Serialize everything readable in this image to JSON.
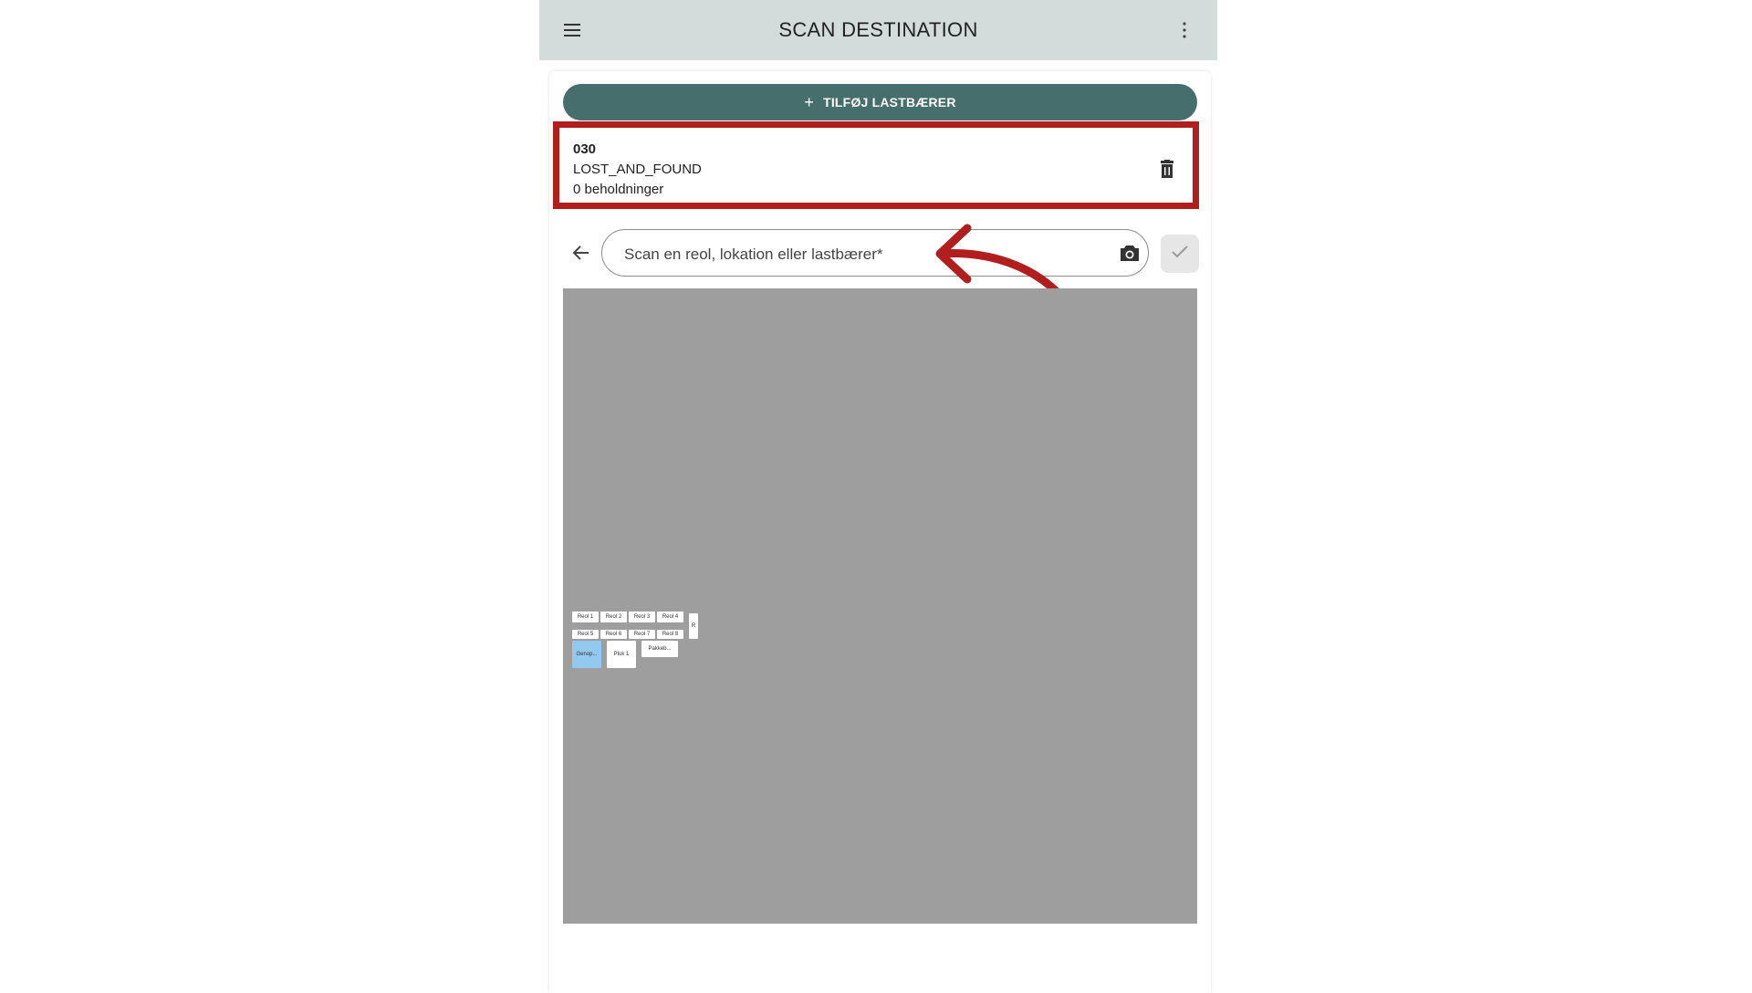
{
  "appbar": {
    "title": "SCAN DESTINATION",
    "menu_icon": "hamburger-menu-icon",
    "more_icon": "more-vert-icon"
  },
  "actions": {
    "add_carrier_label": "TILFØJ LASTBÆRER",
    "add_icon": "plus-icon"
  },
  "carrier": {
    "code": "030",
    "name": "LOST_AND_FOUND",
    "holdings": "0 beholdninger",
    "delete_icon": "trash-icon"
  },
  "scan": {
    "placeholder": "Scan en reol, lokation eller lastbærer*",
    "value": "",
    "camera_icon": "camera-icon",
    "confirm_icon": "check-icon",
    "back_icon": "arrow-back-icon"
  },
  "map": {
    "background": "#9e9e9e",
    "shelves_row1": [
      "Reol 1",
      "Reol 2",
      "Reol 3",
      "Reol 4"
    ],
    "shelves_row2": [
      "Reol 5",
      "Reol 6",
      "Reol 7",
      "Reol 8"
    ],
    "side_block": "R",
    "zones": [
      "Genop...",
      "Pluk 1",
      "Pakkeb..."
    ]
  },
  "colors": {
    "appbar": "#d3dcda",
    "primary_button": "#456e6d",
    "highlight": "#b01e1e",
    "selected_zone": "#93c8ef"
  }
}
